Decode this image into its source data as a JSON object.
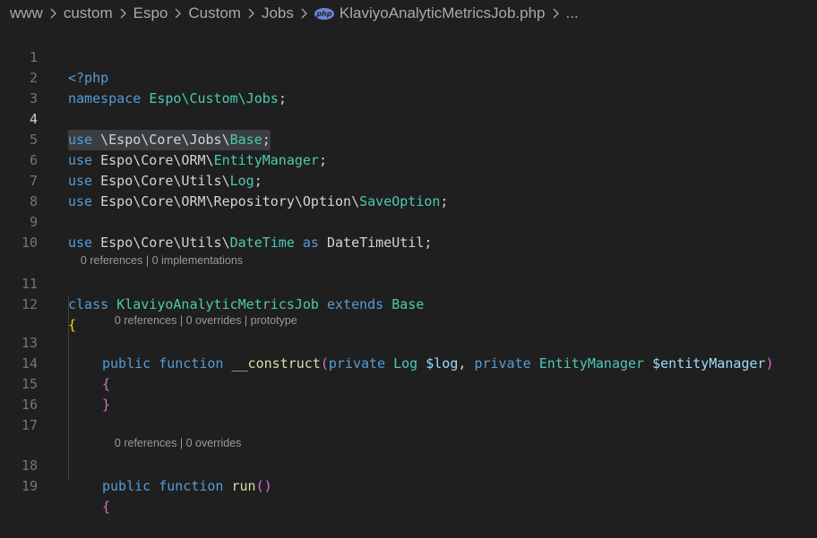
{
  "breadcrumb": {
    "items": [
      "www",
      "custom",
      "Espo",
      "Custom",
      "Jobs"
    ],
    "file_badge": "php",
    "file_name": "KlaviyoAnalyticMetricsJob.php",
    "more": "..."
  },
  "gutter": {
    "line_numbers": [
      "1",
      "2",
      "3",
      "4",
      "5",
      "6",
      "7",
      "8",
      "9",
      "10",
      "11",
      "12",
      "13",
      "14",
      "15",
      "16",
      "17",
      "18",
      "19"
    ],
    "active_line": "4"
  },
  "code": {
    "l1": {
      "open_tag": "<?php"
    },
    "l2": {
      "kw": "namespace",
      "ns": "Espo\\Custom\\Jobs",
      "semi": ";"
    },
    "l4": {
      "kw": "use",
      "path": " \\Espo\\Core\\Jobs\\",
      "cls": "Base",
      "semi": ";"
    },
    "l5": {
      "kw": "use",
      "path": " Espo\\Core\\ORM\\",
      "cls": "EntityManager",
      "semi": ";"
    },
    "l6": {
      "kw": "use",
      "path": " Espo\\Core\\Utils\\",
      "cls": "Log",
      "semi": ";"
    },
    "l7": {
      "kw": "use",
      "path": " Espo\\Core\\ORM\\Repository\\Option\\",
      "cls": "SaveOption",
      "semi": ";"
    },
    "l9": {
      "kw": "use",
      "path": " Espo\\Core\\Utils\\",
      "cls": "DateTime",
      "as": "as",
      "alias": "DateTimeUtil",
      "semi": ";"
    },
    "l11": {
      "kw": "class",
      "cls": "KlaviyoAnalyticMetricsJob",
      "extends": "extends",
      "base": "Base"
    },
    "l12": {
      "brace": "{"
    },
    "l13": {
      "public": "public",
      "function": "function",
      "name": "__construct",
      "open": "(",
      "private1": "private",
      "type1": "Log",
      "var1": "$log",
      "comma": ",",
      "private2": "private",
      "type2": "EntityManager",
      "var2": "$entityManager",
      "close": ")"
    },
    "l14": {
      "brace": "{"
    },
    "l15": {
      "brace": "}"
    },
    "l18": {
      "public": "public",
      "function": "function",
      "name": "run",
      "parens": "()"
    },
    "l19": {
      "brace": "{"
    }
  },
  "lenses": {
    "class": {
      "refs": "0 references",
      "sep": " | ",
      "impls": "0 implementations"
    },
    "construct": {
      "refs": "0 references",
      "sep1": " | ",
      "overrides": "0 overrides",
      "sep2": " | ",
      "proto": "prototype"
    },
    "run": {
      "refs": "0 references",
      "sep": " | ",
      "overrides": "0 overrides"
    }
  },
  "colors": {
    "background": "#1f1f1f",
    "keyword": "#569cd6",
    "type": "#4ec9b0",
    "function": "#dcdcaa",
    "variable": "#9cdcfe",
    "bracket_gold": "#ffd700",
    "bracket_magenta": "#da70d6"
  }
}
